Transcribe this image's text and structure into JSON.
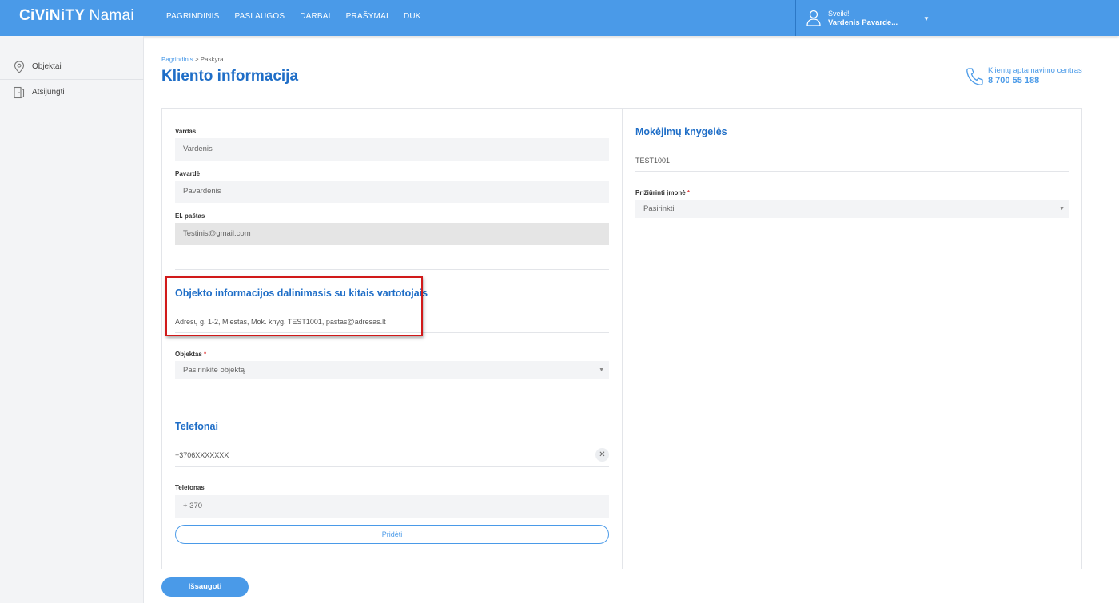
{
  "header": {
    "logo_bold": "CiViNiTY",
    "logo_light": "Namai",
    "nav": [
      "PAGRINDINIS",
      "PASLAUGOS",
      "DARBAI",
      "PRAŠYMAI",
      "DUK"
    ],
    "user_greeting": "Sveiki!",
    "user_name": "Vardenis Pavarde..."
  },
  "sidebar": {
    "items": [
      {
        "label": "Objektai",
        "icon": "location-pin-icon"
      },
      {
        "label": "Atsijungti",
        "icon": "logout-door-icon"
      }
    ]
  },
  "breadcrumb": {
    "home": "Pagrindinis",
    "separator": ">",
    "current": "Paskyra"
  },
  "page_title": "Kliento informacija",
  "support": {
    "label": "Klientų aptarnavimo centras",
    "phone": "8 700 55 188"
  },
  "form": {
    "first_name": {
      "label": "Vardas",
      "value": "Vardenis"
    },
    "last_name": {
      "label": "Pavardė",
      "value": "Pavardenis"
    },
    "email": {
      "label": "El. paštas",
      "value": "Testinis@gmail.com"
    },
    "sharing": {
      "title": "Objekto informacijos dalinimasis su kitais vartotojais",
      "entry": "Adresų g. 1-2, Miestas, Mok. knyg. TEST1001, pastas@adresas.lt"
    },
    "object": {
      "label": "Objektas",
      "required": "*",
      "placeholder": "Pasirinkite objektą"
    },
    "phones": {
      "title": "Telefonai",
      "existing": "+3706XXXXXXX",
      "new_label": "Telefonas",
      "new_placeholder": "+ 370",
      "add_label": "Pridėti"
    },
    "payment_books": {
      "title": "Mokėjimų knygelės",
      "value": "TEST1001",
      "company_label": "Prižiūrinti įmonė",
      "company_required": "*",
      "company_placeholder": "Pasirinkti"
    }
  },
  "save_label": "Išsaugoti",
  "colors": {
    "accent": "#4a9ae8",
    "title": "#1f6ec7",
    "highlight": "#d11a1a"
  }
}
